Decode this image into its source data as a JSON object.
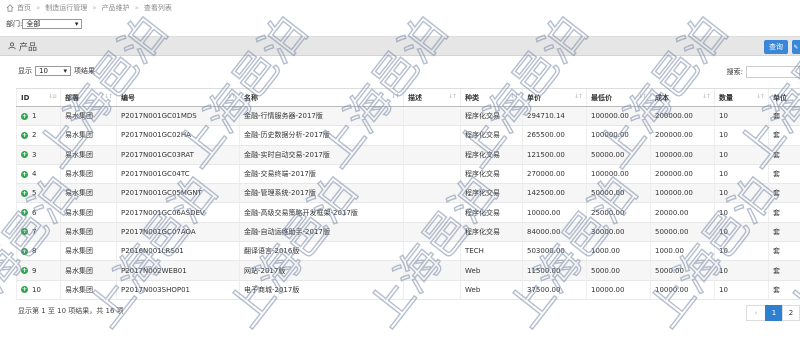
{
  "breadcrumb": [
    "首页",
    "制造运行管理",
    "产品维护",
    "查看列表"
  ],
  "filter": {
    "label": "部门:",
    "value": "全部"
  },
  "panel": {
    "title": "产品",
    "query_button": "查询"
  },
  "length": {
    "prefix": "显示",
    "value": "10",
    "suffix": "项结果"
  },
  "search": {
    "label": "搜索:",
    "placeholder": ""
  },
  "columns": [
    "ID",
    "部署",
    "编号",
    "名称",
    "描述",
    "种类",
    "单价",
    "最低价",
    "成本",
    "数量",
    "单位"
  ],
  "rows": [
    [
      "1",
      "易水集团",
      "P2017N001GC01MDS",
      "金融-行情服务器-2017版",
      "",
      "程序化交易",
      "294710.14",
      "100000.00",
      "200000.00",
      "10",
      "套"
    ],
    [
      "2",
      "易水集团",
      "P2017N001GC02HA",
      "金融-历史数据分析-2017版",
      "",
      "程序化交易",
      "265500.00",
      "100000.00",
      "200000.00",
      "10",
      "套"
    ],
    [
      "3",
      "易水集团",
      "P2017N001GC03RAT",
      "金融-实时自动交易-2017版",
      "",
      "程序化交易",
      "121500.00",
      "50000.00",
      "100000.00",
      "10",
      "套"
    ],
    [
      "4",
      "易水集团",
      "P2017N001GC04TC",
      "金融-交易终端-2017版",
      "",
      "程序化交易",
      "270000.00",
      "100000.00",
      "200000.00",
      "10",
      "套"
    ],
    [
      "5",
      "易水集团",
      "P2017N001GC05MGNT",
      "金融-管理系统-2017版",
      "",
      "程序化交易",
      "142500.00",
      "50000.00",
      "100000.00",
      "10",
      "套"
    ],
    [
      "6",
      "易水集团",
      "P2017N001GC06ASDEV",
      "金融-高级交易策略开发框架-2017版",
      "",
      "程序化交易",
      "10000.00",
      "25000.00",
      "20000.00",
      "10",
      "套"
    ],
    [
      "7",
      "易水集团",
      "P2017N001GC07AOA",
      "金融-自动运维助手-2017版",
      "",
      "程序化交易",
      "84000.00",
      "30000.00",
      "50000.00",
      "10",
      "套"
    ],
    [
      "8",
      "易水集团",
      "P2016N001LRS01",
      "翻译语言-2016版",
      "",
      "TECH",
      "503000.00",
      "1000.00",
      "1000.00",
      "10",
      "套"
    ],
    [
      "9",
      "易水集团",
      "P2017N002WEB01",
      "网站-2017版",
      "",
      "Web",
      "11500.00",
      "5000.00",
      "5000.00",
      "10",
      "套"
    ],
    [
      "10",
      "易水集团",
      "P2017N003SHOP01",
      "电子商城-2017版",
      "",
      "Web",
      "37500.00",
      "10000.00",
      "10000.00",
      "10",
      "套"
    ]
  ],
  "footer": {
    "info": "显示第 1 至 10 项结果，共 16 项"
  },
  "pager": {
    "prev": "‹",
    "pages": [
      "1",
      "2"
    ]
  },
  "watermark_text": "上海邑泊",
  "colors": {
    "accent": "#2f7fd0",
    "plus": "#2ea44f",
    "header_bg": "#e6e6e6"
  }
}
